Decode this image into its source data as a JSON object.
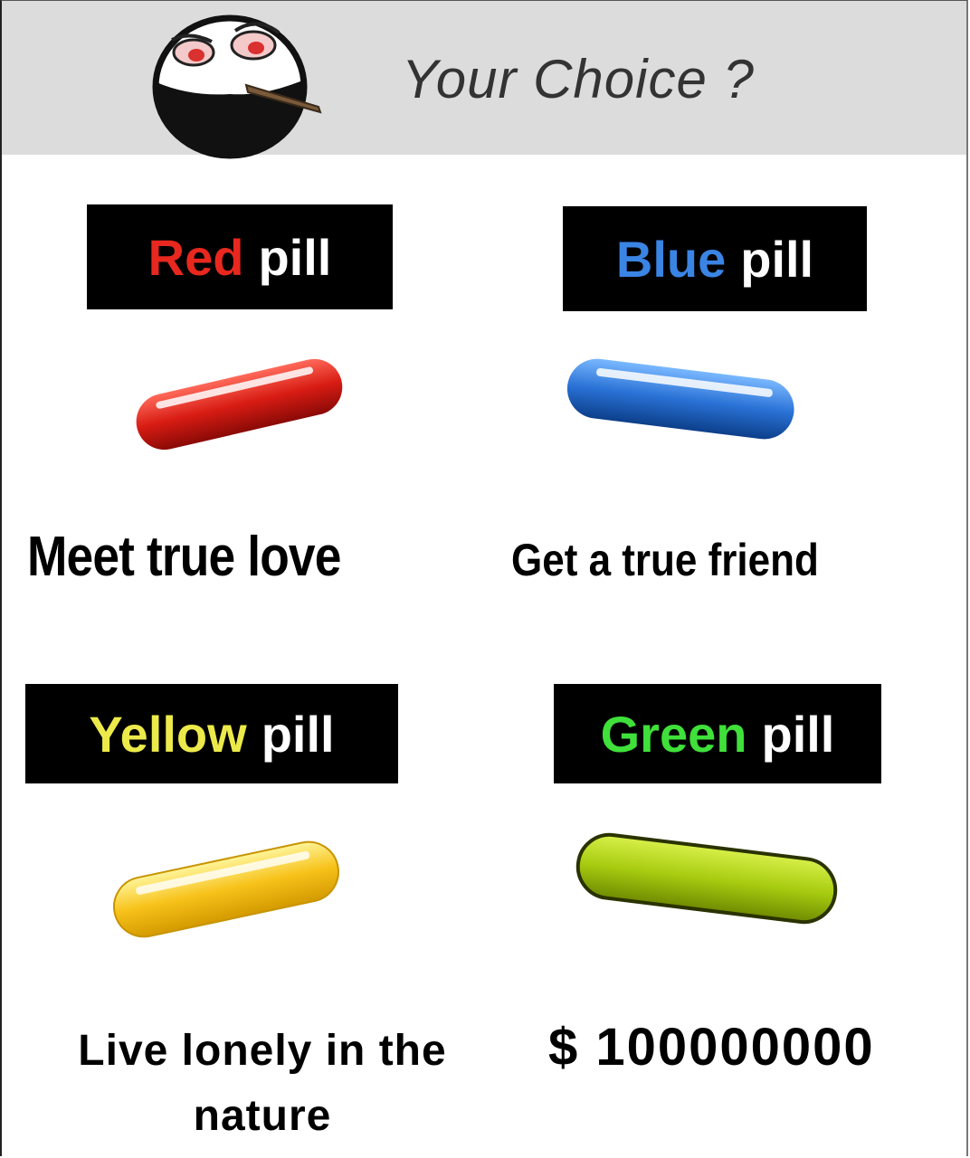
{
  "header": {
    "title": "Your Choice ?"
  },
  "icons": {
    "face": "smirking-ball-face-with-cigarette"
  },
  "pills": [
    {
      "color_word": "Red",
      "suffix": "pill",
      "color": "#e8281e",
      "description": "Meet true love"
    },
    {
      "color_word": "Blue",
      "suffix": "pill",
      "color": "#3a84e4",
      "description": "Get a true friend"
    },
    {
      "color_word": "Yellow",
      "suffix": "pill",
      "color": "#ecea4a",
      "description": "Live lonely in the nature"
    },
    {
      "color_word": "Green",
      "suffix": "pill",
      "color": "#3fe03a",
      "description": "$ 100000000"
    }
  ]
}
